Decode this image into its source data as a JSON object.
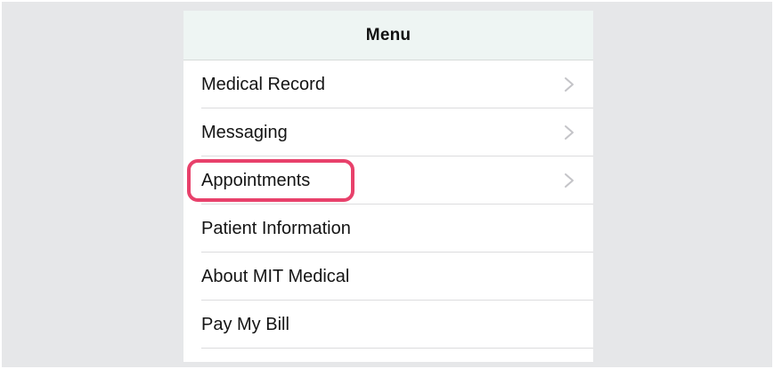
{
  "nav": {
    "title": "Menu"
  },
  "menu": {
    "items": [
      {
        "label": "Medical Record",
        "chevron": true
      },
      {
        "label": "Messaging",
        "chevron": true
      },
      {
        "label": "Appointments",
        "chevron": true,
        "highlighted": true
      },
      {
        "label": "Patient Information",
        "chevron": false
      },
      {
        "label": "About MIT Medical",
        "chevron": false
      },
      {
        "label": "Pay My Bill",
        "chevron": false
      }
    ]
  },
  "colors": {
    "highlight": "#e8416b",
    "nav_background": "#eef5f3",
    "chevron": "#c4c4c8",
    "bezel": "#e6e7e9"
  },
  "icons": {
    "chevron": "chevron-right-icon"
  }
}
